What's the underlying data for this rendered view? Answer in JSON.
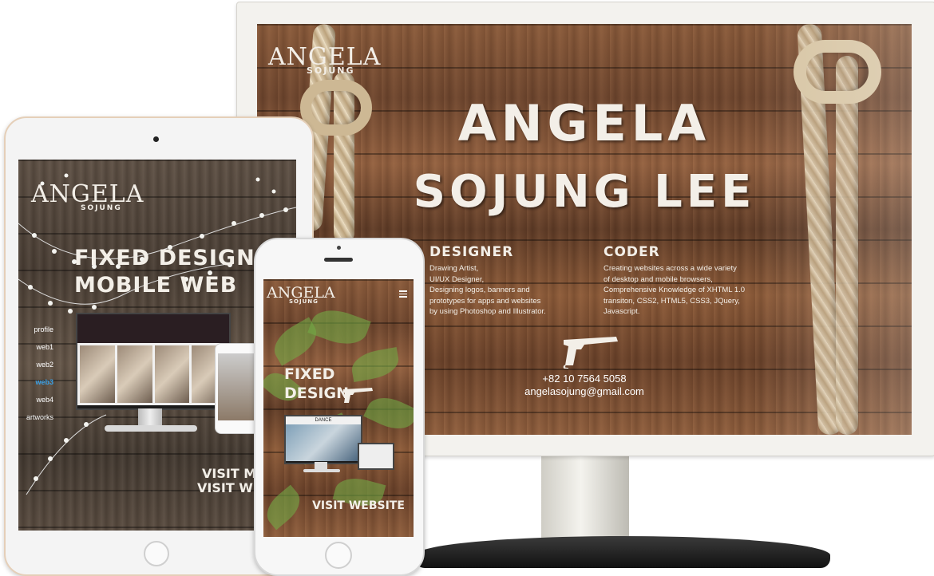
{
  "desktop": {
    "logo_main": "ANGELA",
    "logo_sub": "SOJUNG",
    "name_line1": "ANGELA",
    "name_line2": "SOJUNG LEE",
    "designer": {
      "heading": "DESIGNER",
      "lines": [
        "Drawing Artist,",
        "UI/UX Designer,",
        "Designing logos, banners and",
        "prototypes for apps and websites",
        "by using Photoshop and Illustrator."
      ]
    },
    "coder": {
      "heading": "CODER",
      "lines": [
        "Creating websites across a wide variety",
        "of desktop and mobile browsers,",
        "Comprehensive Knowledge of XHTML 1.0",
        "transiton, CSS2, HTML5, CSS3, JQuery,",
        "Javascript."
      ]
    },
    "phone_number": "+82 10 7564 5058",
    "email": "angelasojung@gmail.com",
    "gun_icon": "pistol-icon"
  },
  "tablet": {
    "logo_main": "ANGELA",
    "logo_sub": "SOJUNG",
    "headline1": "FIXED DESIGN &",
    "headline2": "MOBILE WEB",
    "nav": [
      "profile",
      "web1",
      "web2",
      "web3",
      "web4",
      "artworks"
    ],
    "active_nav": "web3",
    "active_color": "#3aa0e6",
    "visit1": "VISIT MOB",
    "visit2": "VISIT WEBS"
  },
  "phone": {
    "logo_main": "ANGELA",
    "logo_sub": "SOJUNG",
    "menu_icon": "hamburger-menu-icon",
    "headline1": "FIXED",
    "headline2": "DESIGN",
    "mini_title": "DANCE",
    "visit": "VISIT WEBSITE"
  },
  "colors": {
    "wood": "#7a4e33",
    "grey_wood": "#54473c",
    "text": "#f3efe8"
  }
}
